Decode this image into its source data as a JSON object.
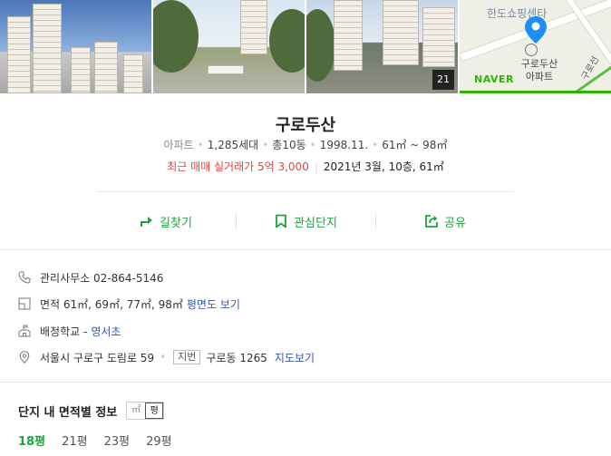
{
  "photos": {
    "count_badge": "21"
  },
  "map": {
    "top_label": "한도쇼핑센타",
    "apartment_label_line1": "구로두산",
    "apartment_label_line2": "아파트",
    "road_label": "구로선",
    "brand": "NAVER",
    "brand_color": "#2db400"
  },
  "summary": {
    "title": "구로두산",
    "type": "아파트",
    "households": "1,285세대",
    "buildings": "총10동",
    "approval_date": "1998.11.",
    "area_range": "61㎡ ~ 98㎡",
    "recent_trade": "최근 매매 실거래가 5억 3,000",
    "recent_trade_detail": "2021년 3월, 10층, 61㎡",
    "accent_red": "#e9423d"
  },
  "actions": [
    {
      "label": "길찾기",
      "icon": "directions-icon"
    },
    {
      "label": "관심단지",
      "icon": "bookmark-icon"
    },
    {
      "label": "공유",
      "icon": "share-icon"
    }
  ],
  "info": {
    "phone": "관리사무소 02-864-5146",
    "area": "면적 61㎡, 69㎡, 77㎡, 98㎡",
    "area_link": "평면도 보기",
    "school_prefix": "배정학교 -",
    "school_link": "영서초",
    "address": "서울시 구로구 도림로 59",
    "address_tag": "지번",
    "lot_address": "구로동 1265",
    "map_link": "지도보기",
    "link_color": "#2f57c5"
  },
  "area_section": {
    "title": "단지 내 면적별 정보",
    "unit_sqm": "㎡",
    "unit_pyeong": "평",
    "tabs": [
      "18평",
      "21평",
      "23평",
      "29평"
    ],
    "selected_tab": "18평",
    "accent_green": "#1aa53a"
  }
}
